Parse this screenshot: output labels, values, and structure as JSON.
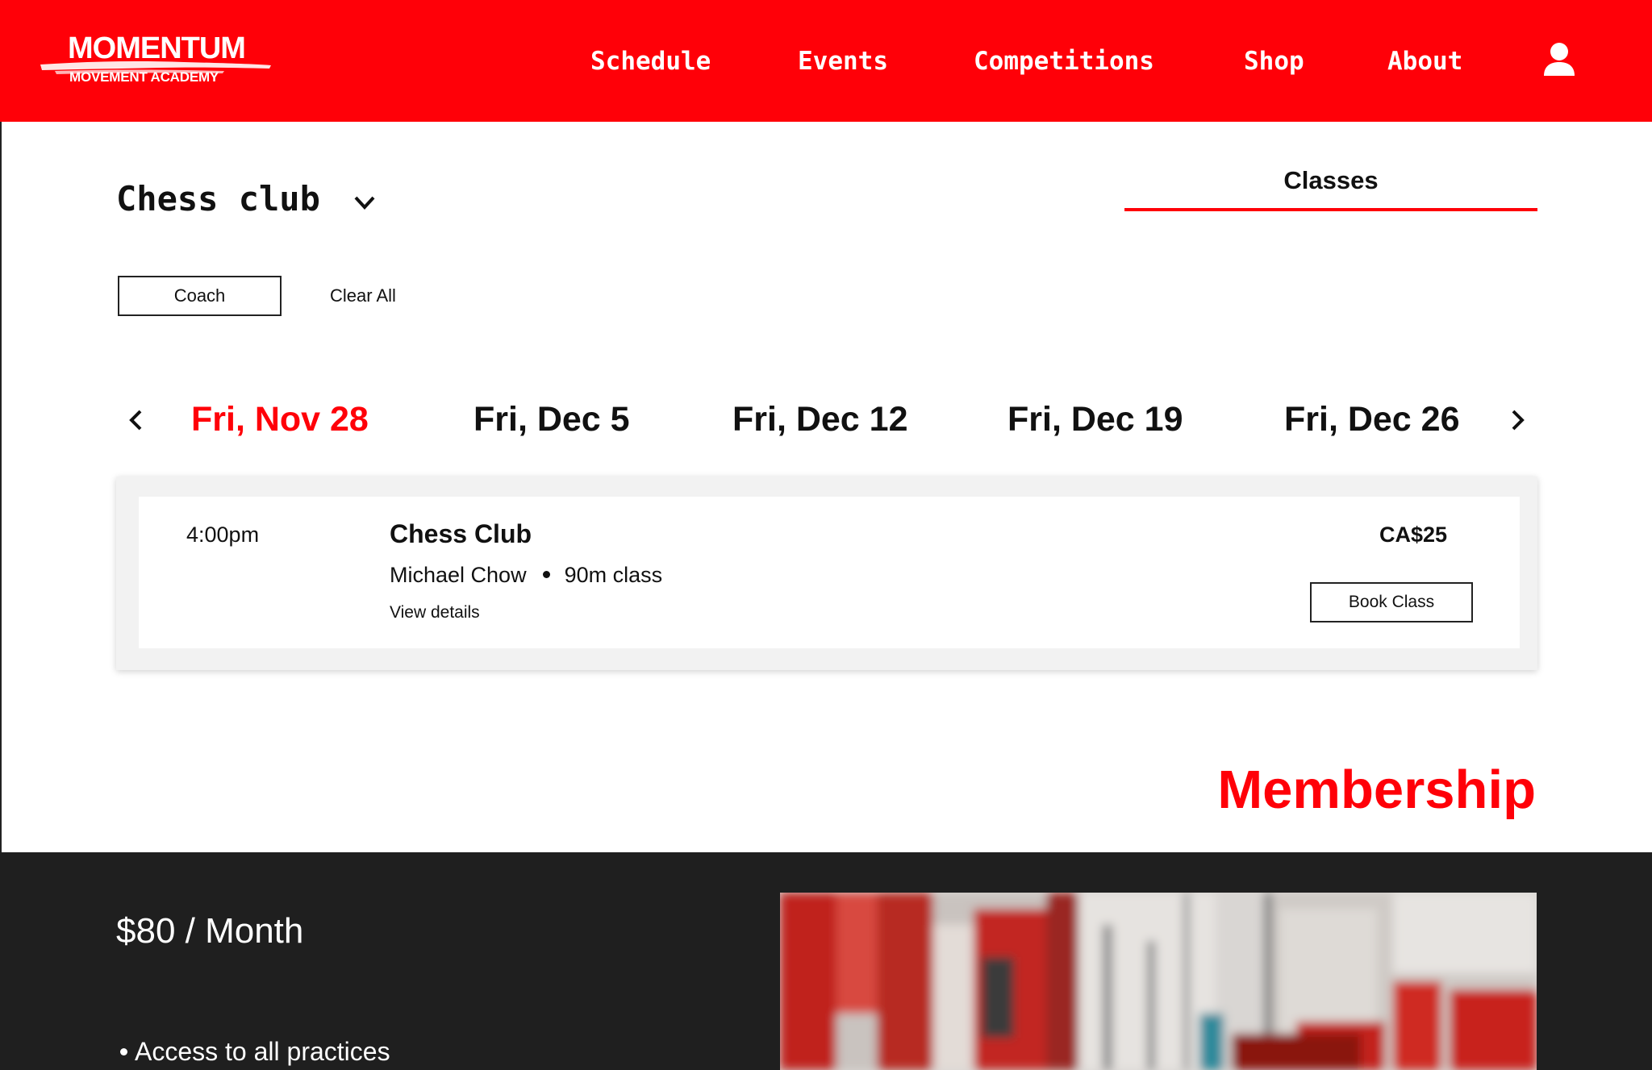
{
  "brand": {
    "name": "MOMENTUM",
    "tagline": "MOVEMENT ACADEMY",
    "color": "#ff0008"
  },
  "nav": {
    "items": [
      {
        "label": "Schedule"
      },
      {
        "label": "Events"
      },
      {
        "label": "Competitions"
      },
      {
        "label": "Shop"
      },
      {
        "label": "About"
      }
    ],
    "account_icon": "user-icon"
  },
  "program": {
    "title": "Chess club",
    "dropdown_icon": "chevron-down-icon"
  },
  "tabs": {
    "active": "Classes"
  },
  "filters": {
    "coach_label": "Coach",
    "clear_label": "Clear All"
  },
  "dates": {
    "items": [
      {
        "label": "Fri, Nov 28",
        "selected": true
      },
      {
        "label": "Fri, Dec 5",
        "selected": false
      },
      {
        "label": "Fri, Dec 12",
        "selected": false
      },
      {
        "label": "Fri, Dec 19",
        "selected": false
      },
      {
        "label": "Fri, Dec 26",
        "selected": false
      }
    ],
    "prev_icon": "chevron-left-icon",
    "next_icon": "chevron-right-icon"
  },
  "class_card": {
    "time": "4:00pm",
    "name": "Chess Club",
    "coach": "Michael Chow",
    "duration": "90m class",
    "details_link": "View details",
    "price": "CA$25",
    "book_label": "Book Class"
  },
  "membership": {
    "heading": "Membership",
    "price": "$80 / Month",
    "benefits": [
      "Access to all practices"
    ]
  }
}
